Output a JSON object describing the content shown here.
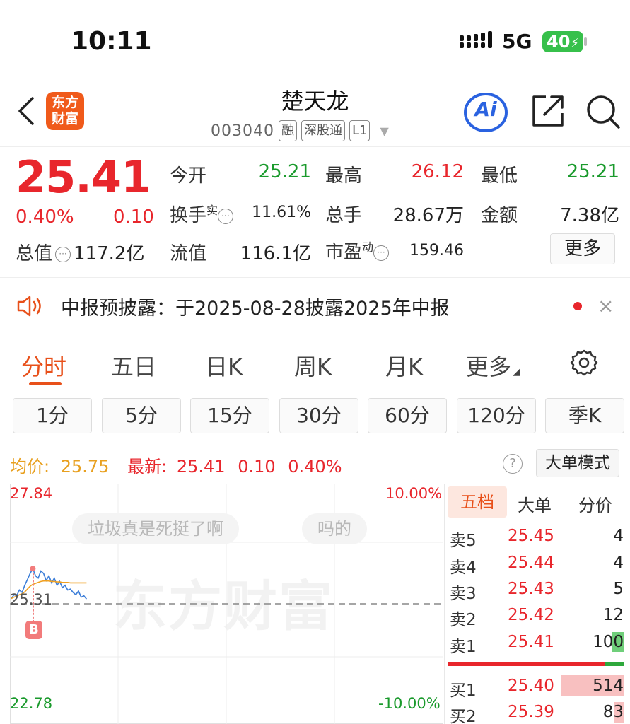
{
  "status_bar": {
    "time": "10:11",
    "network": "5G",
    "battery": "40"
  },
  "nav": {
    "logo_line1": "东方",
    "logo_line2": "财富",
    "stock_name": "楚天龙",
    "stock_code": "003040",
    "tags": [
      "融",
      "深股通",
      "L1"
    ],
    "ai_label": "Ai"
  },
  "quote": {
    "price": "25.41",
    "change_pct": "0.40%",
    "change": "0.10",
    "open_label": "今开",
    "open": "25.21",
    "high_label": "最高",
    "high": "26.12",
    "low_label": "最低",
    "low": "25.21",
    "turnover_label": "换手",
    "turnover_sup": "实",
    "turnover": "11.61%",
    "volume_label": "总手",
    "volume": "28.67万",
    "amount_label": "金额",
    "amount": "7.38亿",
    "mktcap_label": "总值",
    "mktcap": "117.2亿",
    "float_label": "流值",
    "float_cap": "116.1亿",
    "pe_label": "市盈",
    "pe_sup": "动",
    "pe": "159.46",
    "more_label": "更多"
  },
  "notice": {
    "text": "中报预披露：于2025-08-28披露2025年中报",
    "close": "×"
  },
  "tabs": [
    "分时",
    "五日",
    "日K",
    "周K",
    "月K",
    "更多"
  ],
  "periods": [
    "1分",
    "5分",
    "15分",
    "30分",
    "60分",
    "120分",
    "季K"
  ],
  "chart_header": {
    "avg_label": "均价:",
    "avg_value": "25.75",
    "latest_label": "最新:",
    "latest_price": "25.41",
    "latest_change": "0.10",
    "latest_pct": "0.40%",
    "big_order_mode": "大单模式",
    "help": "?"
  },
  "chart": {
    "y_top": "27.84",
    "y_bottom": "22.78",
    "pct_top": "10.00%",
    "pct_bottom": "-10.00%",
    "prev_close_label": "25.31",
    "marker": "B",
    "watermark": "东方财富",
    "danmu": [
      "垃圾真是死挺了啊",
      "吗的"
    ]
  },
  "chart_data": {
    "type": "line",
    "ylim": [
      22.78,
      27.84
    ],
    "prev_close": 25.31,
    "series": [
      {
        "name": "",
        "values": [
          25.42,
          25.5,
          25.48,
          25.6,
          25.55,
          25.7,
          25.82,
          25.95,
          26.05,
          25.9,
          25.85,
          26.0,
          25.95,
          25.8,
          25.9,
          25.75,
          25.85,
          25.7,
          25.78,
          25.65,
          25.7,
          25.6,
          25.62,
          25.55,
          25.5,
          25.58,
          25.45,
          25.48,
          25.41
        ]
      },
      {
        "name": "",
        "values": [
          25.42,
          25.45,
          25.47,
          25.5,
          25.52,
          25.56,
          25.62,
          25.68,
          25.72,
          25.74,
          25.76,
          25.78,
          25.79,
          25.79,
          25.79,
          25.78,
          25.78,
          25.77,
          25.77,
          25.76,
          25.76,
          25.76,
          25.75,
          25.75,
          25.75,
          25.75,
          25.75,
          25.75,
          25.75
        ]
      }
    ]
  },
  "order_book": {
    "tabs": [
      "五档",
      "大单",
      "分价"
    ],
    "sell": [
      {
        "label": "卖5",
        "price": "25.45",
        "vol": "4"
      },
      {
        "label": "卖4",
        "price": "25.44",
        "vol": "4"
      },
      {
        "label": "卖3",
        "price": "25.43",
        "vol": "5"
      },
      {
        "label": "卖2",
        "price": "25.42",
        "vol": "12"
      },
      {
        "label": "卖1",
        "price": "25.41",
        "vol": "100"
      }
    ],
    "buy": [
      {
        "label": "买1",
        "price": "25.40",
        "vol": "514"
      },
      {
        "label": "买2",
        "price": "25.39",
        "vol": "83"
      }
    ]
  }
}
